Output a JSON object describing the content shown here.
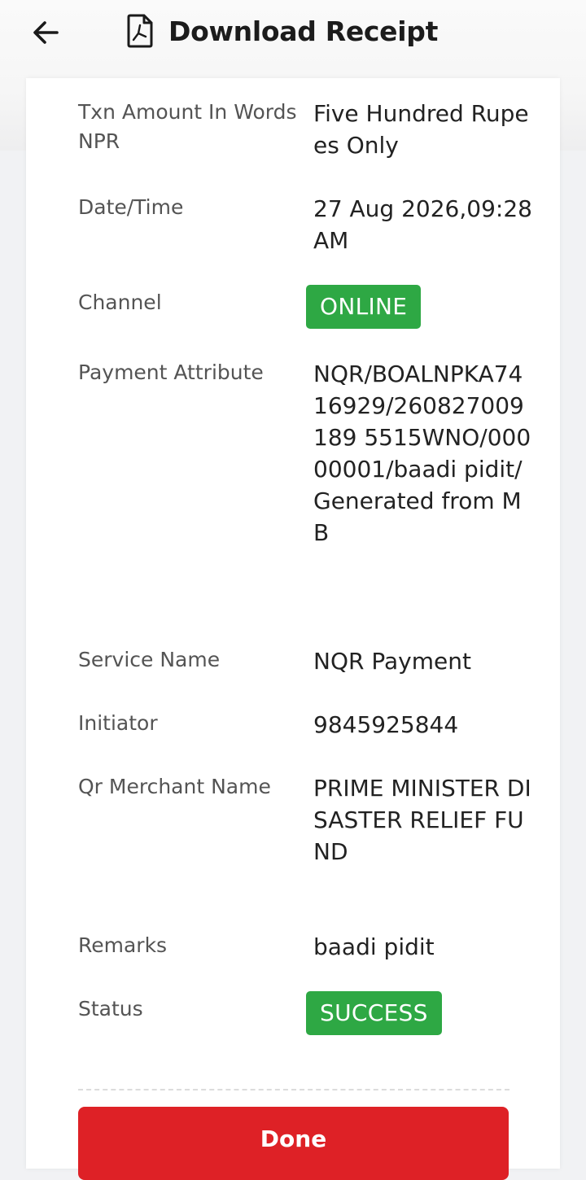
{
  "header": {
    "title": "Download Receipt",
    "back_icon": "arrow-left-icon",
    "pdf_icon": "pdf-file-icon"
  },
  "receipt": {
    "rows": [
      {
        "label": "Txn Amount In Words NPR",
        "value": "Five Hundred Rupees Only"
      },
      {
        "label": "Date/Time",
        "value": "27 Aug 2026,09:28 AM"
      },
      {
        "label": "Channel",
        "value": "ONLINE"
      },
      {
        "label": "Payment Attribute",
        "value": "NQR/BOALNPKA7416929/260827009189 5515WNO/00000001/baadi pidit/Generated from MB"
      },
      {
        "label": "Service Name",
        "value": "NQR Payment"
      },
      {
        "label": "Initiator",
        "value": "9845925844"
      },
      {
        "label": "Qr Merchant Name",
        "value": "PRIME MINISTER DISASTER RELIEF FUND"
      },
      {
        "label": "Remarks",
        "value": "baadi pidit"
      },
      {
        "label": "Status",
        "value": "SUCCESS"
      }
    ]
  },
  "footer": {
    "done_label": "Done"
  },
  "colors": {
    "badge_green": "#2ea844",
    "done_red": "#de2126"
  }
}
